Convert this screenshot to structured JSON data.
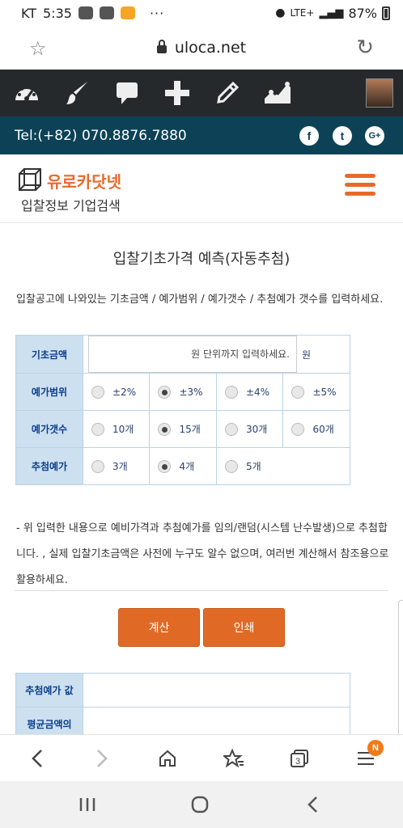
{
  "status_bar": {
    "carrier": "KT",
    "time": "5:35",
    "network": "LTE+",
    "battery": "87%"
  },
  "browser": {
    "url": "uloca.net"
  },
  "toolbar": {
    "icons": [
      "dashboard-icon",
      "brush-icon",
      "comment-icon",
      "plus-icon",
      "pencil-icon",
      "chart-icon"
    ]
  },
  "contact": {
    "tel": "Tel:(+82) 070.8876.7880",
    "social": [
      "f",
      "t",
      "G+"
    ]
  },
  "site": {
    "name": "유로카닷넷",
    "tagline": "입찰정보 기업검색"
  },
  "page": {
    "title": "입찰기초가격 예측(자동추첨)",
    "intro": "입찰공고에 나와있는 기초금액 / 예가범위 / 예가갯수 / 추첨예가 갯수를 입력하세요.",
    "notice": "- 위 입력한 내용으로 예비가격과 추첨예가를 임의/랜덤(시스템 난수발생)으로 추첨합니다. , 실제 입찰기초금액은 사전에 누구도 알수 없으며, 여러번 계산해서 참조용으로 활용하세요."
  },
  "form": {
    "base_amount": {
      "label": "기초금액",
      "placeholder": "원 단위까지 입력하세요.",
      "unit": "원"
    },
    "price_range": {
      "label": "예가범위",
      "options": [
        "±2%",
        "±3%",
        "±4%",
        "±5%"
      ],
      "selected": "±3%"
    },
    "price_count": {
      "label": "예가갯수",
      "options": [
        "10개",
        "15개",
        "30개",
        "60개"
      ],
      "selected": "15개"
    },
    "draw_count": {
      "label": "추첨예가",
      "options": [
        "3개",
        "4개",
        "5개"
      ],
      "selected": "4개"
    }
  },
  "buttons": {
    "calculate": "계산",
    "print": "인쇄"
  },
  "results": {
    "rows": [
      {
        "label": "추첨예가 값",
        "value": ""
      },
      {
        "label": "평균금액의",
        "value": ""
      }
    ]
  },
  "browser_nav": {
    "tab_count": "3",
    "badge": "N"
  },
  "colors": {
    "accent": "#e06a25",
    "toolbar": "#25292b",
    "contact_bar": "#0d4256",
    "label_bg": "#cde0f0",
    "label_text": "#0b3d8c"
  }
}
